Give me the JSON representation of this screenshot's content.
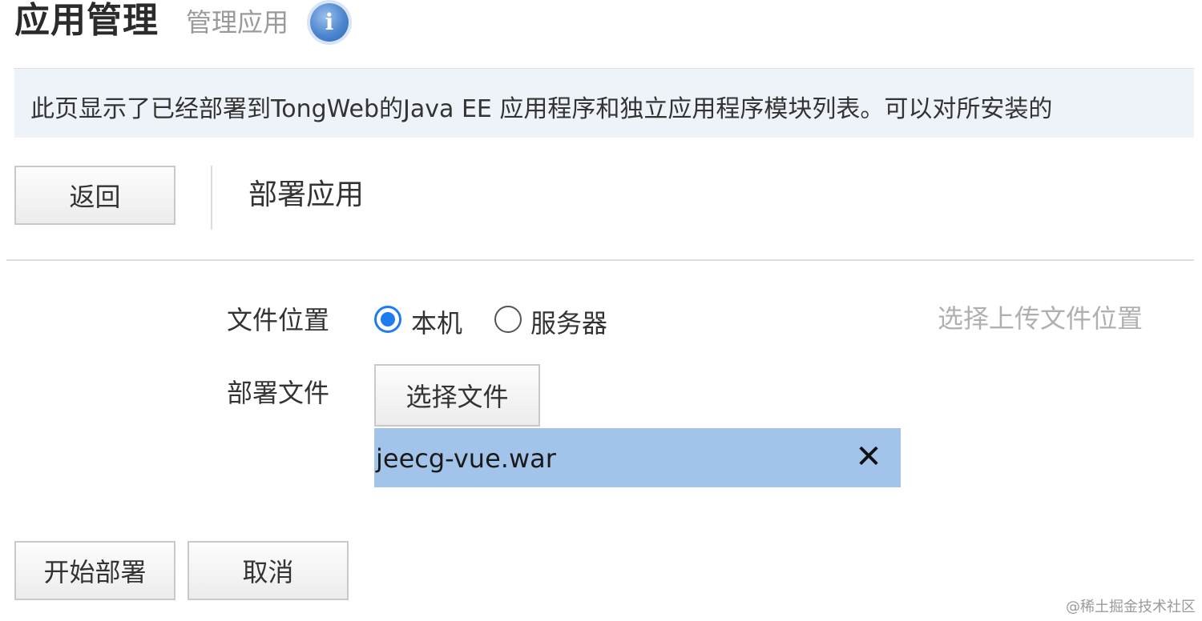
{
  "header": {
    "title": "应用管理",
    "subtitle": "管理应用",
    "info_icon": "info-icon"
  },
  "banner": {
    "text": "此页显示了已经部署到TongWeb的Java EE 应用程序和独立应用程序模块列表。可以对所安装的"
  },
  "toolbar": {
    "back_label": "返回",
    "section_title": "部署应用"
  },
  "form": {
    "location_label": "文件位置",
    "location_options": [
      {
        "label": "本机",
        "checked": true
      },
      {
        "label": "服务器",
        "checked": false
      }
    ],
    "location_hint": "选择上传文件位置",
    "file_label": "部署文件",
    "choose_file_label": "选择文件",
    "selected_file": "jeecg-vue.war",
    "remove_icon": "close-icon"
  },
  "actions": {
    "deploy_label": "开始部署",
    "cancel_label": "取消"
  },
  "watermark": "@稀土掘金技术社区",
  "colors": {
    "banner_bg": "#eef3f9",
    "radio_accent": "#1f7bef",
    "file_chip_bg": "#a3c4ea",
    "hint_text": "#b0b0b0"
  }
}
